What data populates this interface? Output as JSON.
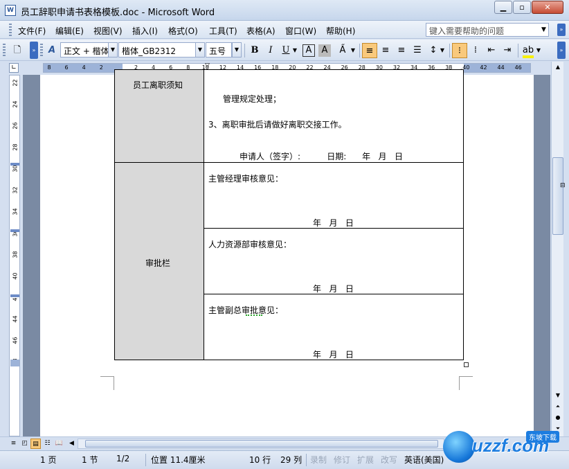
{
  "window": {
    "title": "员工辞职申请书表格模板.doc - Microsoft Word",
    "app_icon": "word-doc-icon",
    "controls": [
      "minimize",
      "maximize",
      "close"
    ]
  },
  "menu": {
    "items": [
      "文件(F)",
      "编辑(E)",
      "视图(V)",
      "插入(I)",
      "格式(O)",
      "工具(T)",
      "表格(A)",
      "窗口(W)",
      "帮助(H)"
    ],
    "help_placeholder": "键入需要帮助的问题"
  },
  "toolbar": {
    "style": "正文 + 楷体",
    "font": "楷体_GB2312",
    "size": "五号",
    "icons": [
      "new-doc-icon",
      "styles-pane-icon",
      "bold-icon",
      "italic-icon",
      "underline-icon",
      "char-border-icon",
      "char-shading-icon",
      "char-scale-icon",
      "align-left-icon",
      "align-center-icon",
      "align-right-icon",
      "justify-icon",
      "line-spacing-icon",
      "numbering-icon",
      "bullets-icon",
      "decrease-indent-icon",
      "increase-indent-icon",
      "highlight-icon"
    ],
    "bold": "B",
    "italic": "I",
    "underline": "U",
    "char_border": "A",
    "char_shading": "A",
    "highlight_color": "#f7f000"
  },
  "ruler": {
    "ticks": [
      "8",
      "6",
      "4",
      "2",
      "",
      "2",
      "4",
      "6",
      "8",
      "10",
      "12",
      "14",
      "16",
      "18",
      "20",
      "22",
      "24",
      "26",
      "28",
      "30",
      "32",
      "34",
      "36",
      "38",
      "40",
      "42",
      "44",
      "46"
    ],
    "vticks": [
      "22",
      "24",
      "26",
      "28",
      "30",
      "32",
      "34",
      "36",
      "38",
      "40",
      "42",
      "44",
      "46",
      "48"
    ]
  },
  "document": {
    "section1_label": "员工离职须知",
    "rule_line": "管理规定处理；",
    "rule_3": "3、离职审批后请做好离职交接工作。",
    "applicant_line": "申请人（签字）:          日期:      年   月   日",
    "approval_label": "审批栏",
    "approvals": [
      {
        "title": "主管经理审核意见：",
        "date": "年   月   日"
      },
      {
        "title": "人力资源部审核意见：",
        "date": "年   月   日"
      },
      {
        "title": "主管副总审批意见：",
        "date": "年   月   日"
      }
    ]
  },
  "status": {
    "page": "1 页",
    "section": "1 节",
    "page_of": "1/2",
    "position": "位置 11.4厘米",
    "line": "10 行",
    "column": "29 列",
    "rec": "录制",
    "trk": "修订",
    "ext": "扩展",
    "ovr": "改写",
    "language": "英语(美国)"
  },
  "watermark": {
    "text": "uzzf.com",
    "tag": "东坡下载"
  }
}
